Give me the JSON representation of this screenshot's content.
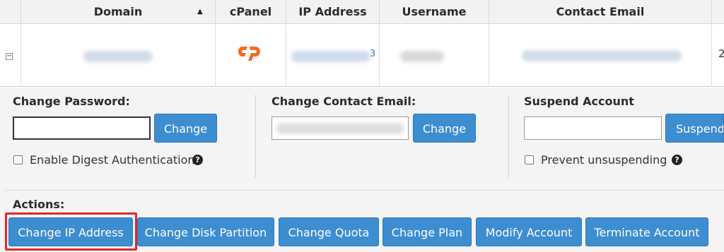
{
  "table": {
    "headers": {
      "domain": "Domain",
      "cpanel": "cPanel",
      "ip_address": "IP Address",
      "username": "Username",
      "contact_email": "Contact Email"
    },
    "sort_indicator": "▲",
    "row": {
      "expand_toggle": "−",
      "ip_suffix_visible": "3",
      "truncated_next_column": "2"
    }
  },
  "change_password": {
    "title": "Change Password:",
    "input_value": "",
    "button": "Change",
    "checkbox_label": "Enable Digest Authentication",
    "checkbox_checked": false
  },
  "change_contact_email": {
    "title": "Change Contact Email:",
    "button": "Change"
  },
  "suspend_account": {
    "title": "Suspend Account",
    "input_value": "",
    "button": "Suspend",
    "checkbox_label": "Prevent unsuspending",
    "checkbox_checked": false
  },
  "actions": {
    "title": "Actions:",
    "buttons": [
      "Change IP Address",
      "Change Disk Partition",
      "Change Quota",
      "Change Plan",
      "Modify Account",
      "Terminate Account"
    ]
  },
  "colors": {
    "button_blue": "#3d8dd1",
    "cpanel_orange": "#f26b21",
    "highlight_red": "#e2272e"
  },
  "icons": {
    "help": "question-circle-icon",
    "sort": "sort-ascending-icon",
    "expand": "collapse-toggle-icon"
  }
}
